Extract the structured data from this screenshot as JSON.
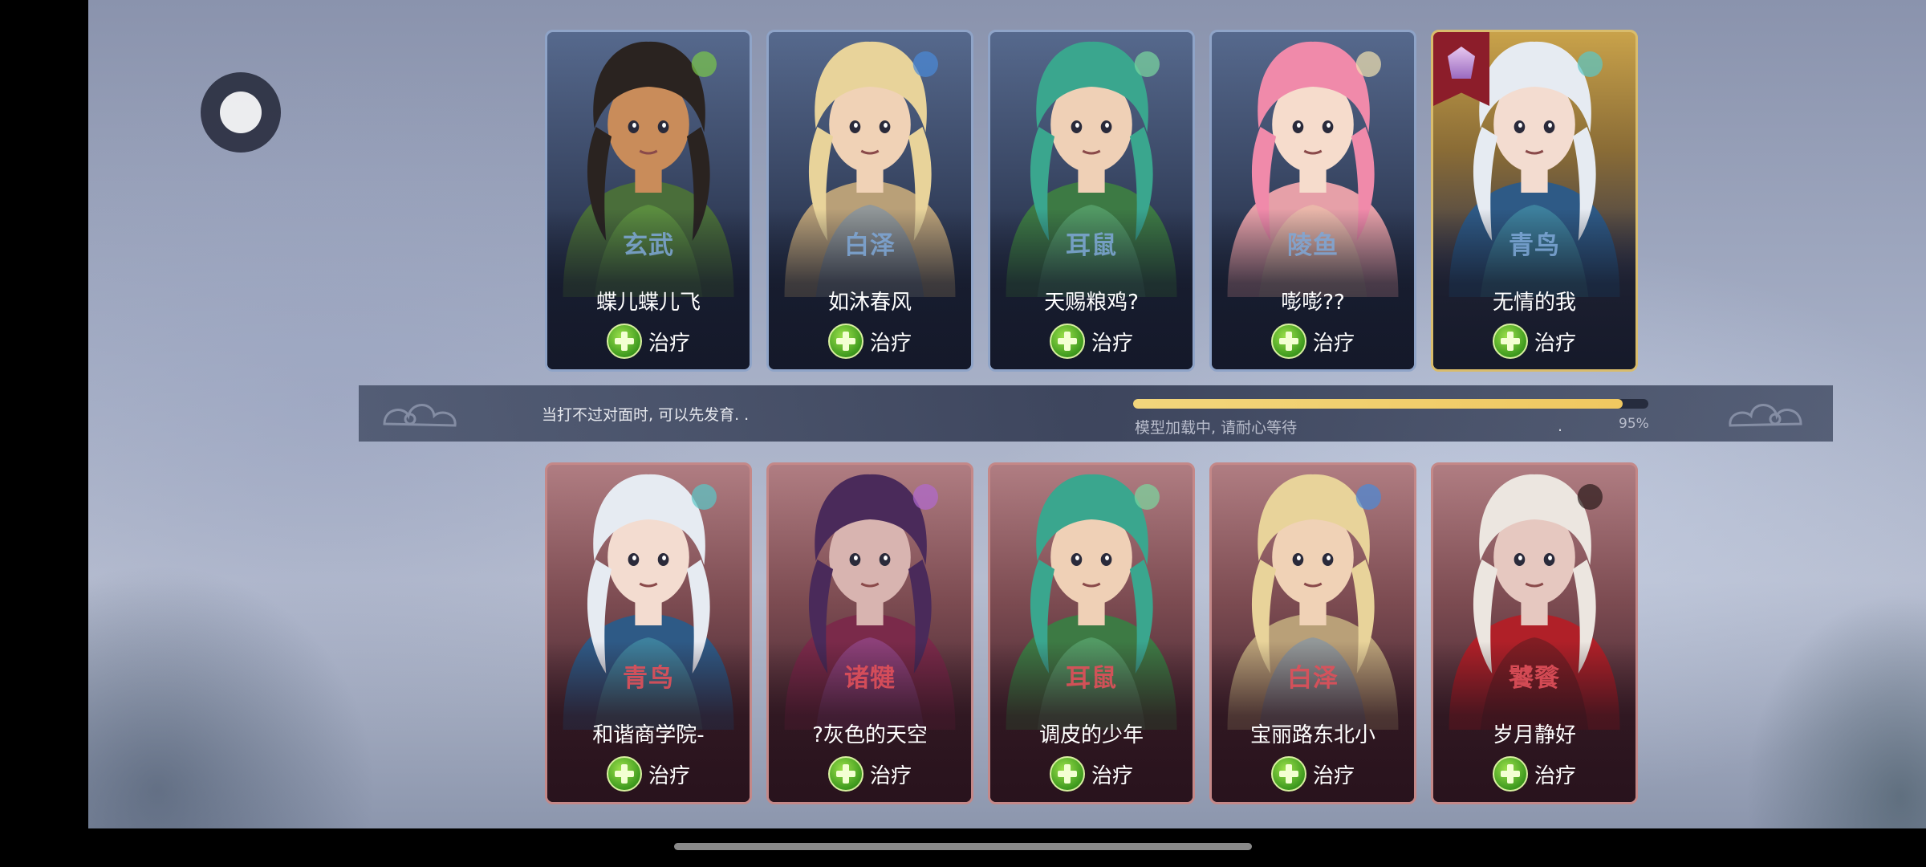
{
  "top_team": [
    {
      "hero": "玄武",
      "player": "蝶儿蝶儿飞",
      "skill": "治疗",
      "frame": "blue",
      "skin": "#c98c5a",
      "hair": "#2a2320",
      "outfit": "#4a6e3a",
      "accent": "#7bc84a"
    },
    {
      "hero": "白泽",
      "player": "如沐春风",
      "skill": "治疗",
      "frame": "blue",
      "skin": "#f0d2b6",
      "hair": "#e8d39a",
      "outfit": "#b9a078",
      "accent": "#4a8ad8"
    },
    {
      "hero": "耳鼠",
      "player": "天赐粮鸡?",
      "skill": "治疗",
      "frame": "blue",
      "skin": "#efd0b6",
      "hair": "#3aa68e",
      "outfit": "#3d7a44",
      "accent": "#7ad8a0"
    },
    {
      "hero": "陵鱼",
      "player": "嘭嘭??",
      "skill": "治疗",
      "frame": "blue",
      "skin": "#f6dccc",
      "hair": "#f08aaa",
      "outfit": "#e6a0a8",
      "accent": "#f2e2b0"
    },
    {
      "hero": "青鸟",
      "player": "无情的我",
      "skill": "治疗",
      "frame": "gold",
      "skin": "#f3dcd0",
      "hair": "#e6ebf2",
      "outfit": "#2e5a86",
      "accent": "#5ac8c8"
    }
  ],
  "bottom_team": [
    {
      "hero": "青鸟",
      "player": "和谐商学院-",
      "skill": "治疗",
      "frame": "red",
      "skin": "#f3dcd0",
      "hair": "#e6ebf2",
      "outfit": "#2e5a86",
      "accent": "#5ac8c8"
    },
    {
      "hero": "诸犍",
      "player": "?灰色的天空",
      "skill": "治疗",
      "frame": "red",
      "skin": "#d8b4b0",
      "hair": "#4a2a5a",
      "outfit": "#7a2a4a",
      "accent": "#b06ad0"
    },
    {
      "hero": "耳鼠",
      "player": "调皮的少年",
      "skill": "治疗",
      "frame": "red",
      "skin": "#efd0b6",
      "hair": "#3aa68e",
      "outfit": "#3d7a44",
      "accent": "#7ad8a0"
    },
    {
      "hero": "白泽",
      "player": "宝丽路东北小",
      "skill": "治疗",
      "frame": "red",
      "skin": "#f0d2b6",
      "hair": "#e8d39a",
      "outfit": "#b9a078",
      "accent": "#4a8ad8"
    },
    {
      "hero": "饕餮",
      "player": "岁月静好",
      "skill": "治疗",
      "frame": "red",
      "skin": "#e6c8c0",
      "hair": "#ece6e0",
      "outfit": "#b02028",
      "accent": "#2a1a1a"
    }
  ],
  "loading": {
    "tip": "当打不过对面时, 可以先发育. .",
    "status": "模型加载中, 请耐心等待",
    "dot": ".",
    "progress": 0.95,
    "percent_label": "95%"
  },
  "icons": {
    "floating_button": "assistive-touch-icon",
    "skill": "heal-cross-icon",
    "rank_badge": "rank-banner-icon"
  }
}
